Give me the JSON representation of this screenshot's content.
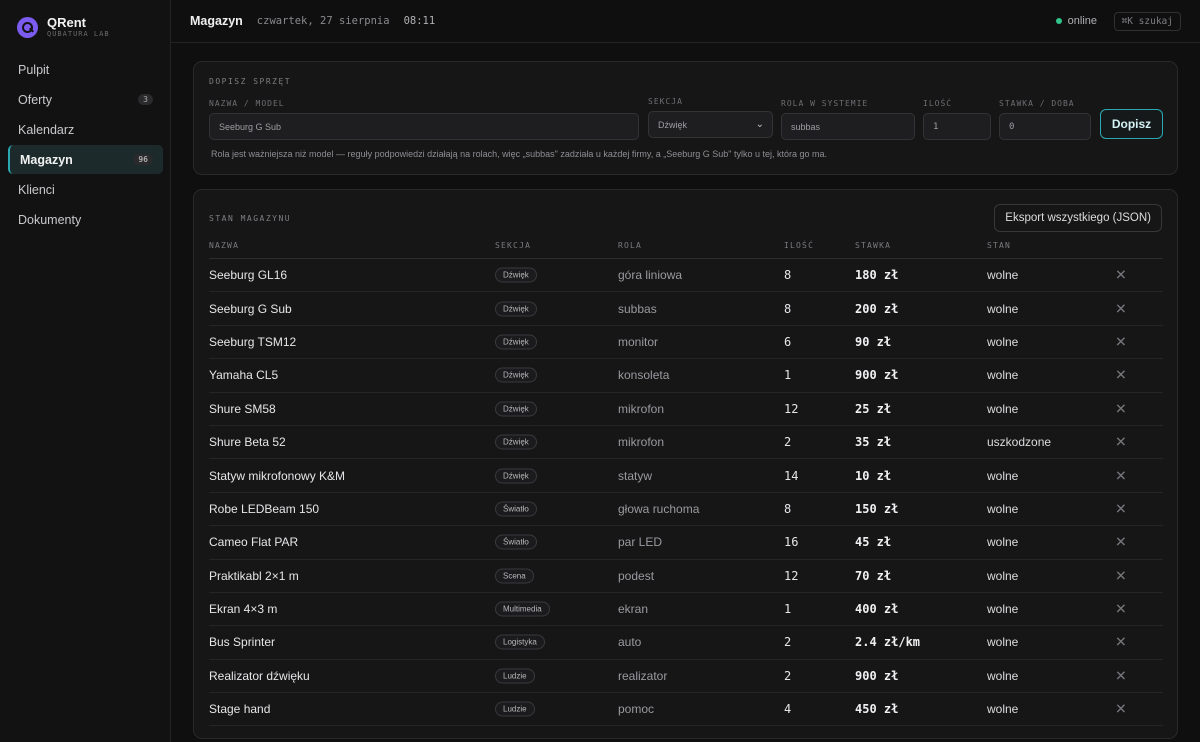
{
  "app": {
    "name": "QRent",
    "subtitle": "QUBATURA LAB",
    "accent": "#2aa9b3",
    "logo_color": "#7c5cf0"
  },
  "nav": [
    {
      "label": "Pulpit",
      "badge": ""
    },
    {
      "label": "Oferty",
      "badge": "3"
    },
    {
      "label": "Kalendarz",
      "badge": ""
    },
    {
      "label": "Magazyn",
      "badge": "96",
      "active": true
    },
    {
      "label": "Klienci",
      "badge": ""
    },
    {
      "label": "Dokumenty",
      "badge": ""
    }
  ],
  "topbar": {
    "title": "Magazyn",
    "date": "czwartek, 27 sierpnia",
    "time": "08:11",
    "status": "online",
    "status_color": "#31c48d",
    "search": "⌘K szukaj"
  },
  "add_form": {
    "heading": "DOPISZ SPRZĘT",
    "name_label": "NAZWA / MODEL",
    "name_value": "Seeburg G Sub",
    "section_label": "SEKCJA",
    "section_value": "Dźwięk",
    "role_label": "ROLA W SYSTEMIE",
    "role_value": "subbas",
    "qty_label": "ILOŚĆ",
    "qty_value": "1",
    "rate_label": "STAWKA / DOBA",
    "rate_value": "0",
    "submit": "Dopisz",
    "hint": "Rola jest ważniejsza niż model — reguły podpowiedzi działają na rolach, więc „subbas\" zadziała u każdej firmy, a „Seeburg G Sub\" tylko u tej, która go ma."
  },
  "stock": {
    "heading": "STAN MAGAZYNU",
    "export": "Eksport wszystkiego (JSON)",
    "columns": {
      "name": "NAZWA",
      "section": "SEKCJA",
      "role": "ROLA",
      "qty": "ILOŚĆ",
      "rate": "STAWKA",
      "state": "STAN"
    },
    "rows": [
      {
        "name": "Seeburg GL16",
        "section": "Dźwięk",
        "role": "góra liniowa",
        "qty": "8",
        "rate": "180 zł",
        "state": "wolne"
      },
      {
        "name": "Seeburg G Sub",
        "section": "Dźwięk",
        "role": "subbas",
        "qty": "8",
        "rate": "200 zł",
        "state": "wolne"
      },
      {
        "name": "Seeburg TSM12",
        "section": "Dźwięk",
        "role": "monitor",
        "qty": "6",
        "rate": "90 zł",
        "state": "wolne"
      },
      {
        "name": "Yamaha CL5",
        "section": "Dźwięk",
        "role": "konsoleta",
        "qty": "1",
        "rate": "900 zł",
        "state": "wolne"
      },
      {
        "name": "Shure SM58",
        "section": "Dźwięk",
        "role": "mikrofon",
        "qty": "12",
        "rate": "25 zł",
        "state": "wolne"
      },
      {
        "name": "Shure Beta 52",
        "section": "Dźwięk",
        "role": "mikrofon",
        "qty": "2",
        "rate": "35 zł",
        "state": "uszkodzone"
      },
      {
        "name": "Statyw mikrofonowy K&M",
        "section": "Dźwięk",
        "role": "statyw",
        "qty": "14",
        "rate": "10 zł",
        "state": "wolne"
      },
      {
        "name": "Robe LEDBeam 150",
        "section": "Światło",
        "role": "głowa ruchoma",
        "qty": "8",
        "rate": "150 zł",
        "state": "wolne"
      },
      {
        "name": "Cameo Flat PAR",
        "section": "Światło",
        "role": "par LED",
        "qty": "16",
        "rate": "45 zł",
        "state": "wolne"
      },
      {
        "name": "Praktikabl 2×1 m",
        "section": "Scena",
        "role": "podest",
        "qty": "12",
        "rate": "70 zł",
        "state": "wolne"
      },
      {
        "name": "Ekran 4×3 m",
        "section": "Multimedia",
        "role": "ekran",
        "qty": "1",
        "rate": "400 zł",
        "state": "wolne"
      },
      {
        "name": "Bus Sprinter",
        "section": "Logistyka",
        "role": "auto",
        "qty": "2",
        "rate": "2.4 zł/km",
        "state": "wolne"
      },
      {
        "name": "Realizator dźwięku",
        "section": "Ludzie",
        "role": "realizator",
        "qty": "2",
        "rate": "900 zł",
        "state": "wolne"
      },
      {
        "name": "Stage hand",
        "section": "Ludzie",
        "role": "pomoc",
        "qty": "4",
        "rate": "450 zł",
        "state": "wolne"
      }
    ]
  }
}
